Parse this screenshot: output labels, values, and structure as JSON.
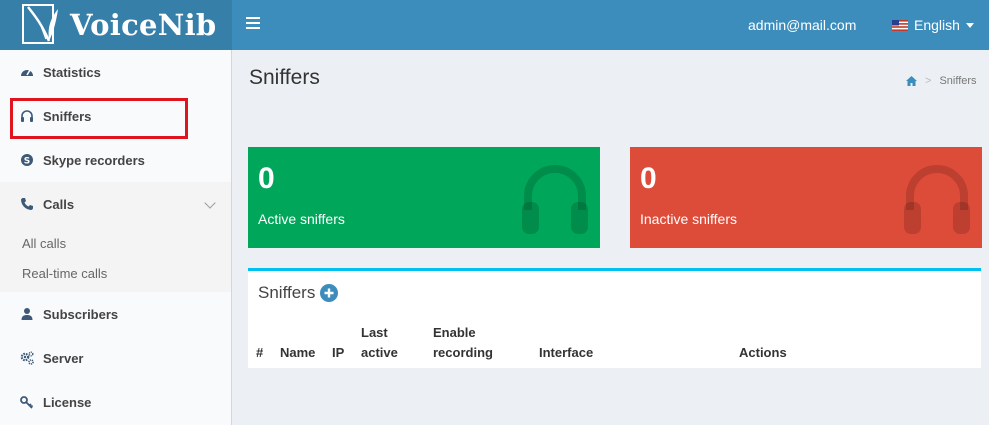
{
  "header": {
    "app_name": "VoiceNib",
    "user_email": "admin@mail.com",
    "language": "English",
    "brand_color": "#3c8dbc"
  },
  "sidebar": {
    "items": [
      {
        "label": "Statistics",
        "icon": "dashboard-icon"
      },
      {
        "label": "Sniffers",
        "icon": "headphones-icon"
      },
      {
        "label": "Skype recorders",
        "icon": "skype-icon"
      },
      {
        "label": "Calls",
        "icon": "phone-icon"
      },
      {
        "label": "Subscribers",
        "icon": "user-icon"
      },
      {
        "label": "Server",
        "icon": "gears-icon"
      },
      {
        "label": "License",
        "icon": "key-icon"
      }
    ],
    "calls_sub": [
      "All calls",
      "Real-time calls"
    ]
  },
  "page": {
    "title": "Sniffers",
    "breadcrumb_current": "Sniffers"
  },
  "stats": {
    "active": {
      "value": "0",
      "label": "Active sniffers",
      "color": "#00a65a"
    },
    "inactive": {
      "value": "0",
      "label": "Inactive sniffers",
      "color": "#dd4b39"
    }
  },
  "table": {
    "title": "Sniffers",
    "headers": {
      "num": "#",
      "name": "Name",
      "ip": "IP",
      "last1": "Last",
      "last2": "active",
      "enable1": "Enable",
      "enable2": "recording",
      "interface": "Interface",
      "actions": "Actions"
    }
  }
}
